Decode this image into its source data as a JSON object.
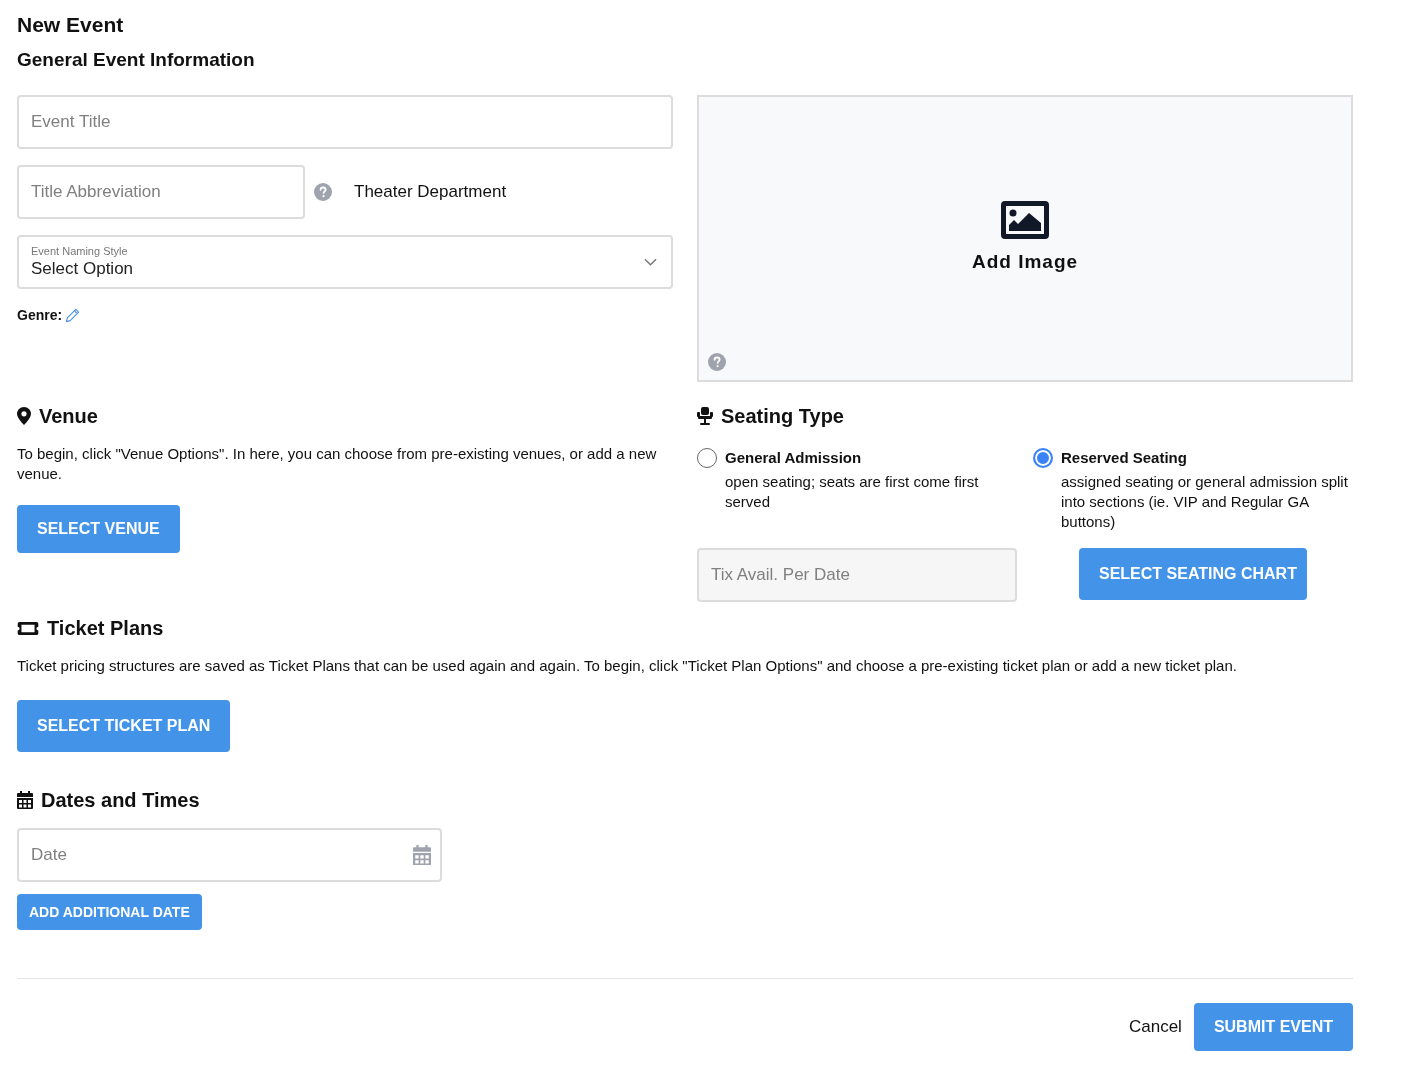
{
  "title": "New Event",
  "subtitle": "General Event Information",
  "event_title": {
    "placeholder": "Event Title"
  },
  "title_abbreviation": {
    "placeholder": "Title Abbreviation"
  },
  "department": "Theater Department",
  "naming_style": {
    "label": "Event Naming Style",
    "value": "Select Option"
  },
  "genre_label": "Genre:",
  "image": {
    "label": "Add Image"
  },
  "venue": {
    "heading": "Venue",
    "text": "To begin, click \"Venue Options\". In here, you can choose from pre-existing venues, or add a new venue.",
    "button": "SELECT VENUE"
  },
  "seating": {
    "heading": "Seating Type",
    "options": [
      {
        "label": "General Admission",
        "description": "open seating; seats are first come first served",
        "selected": false
      },
      {
        "label": "Reserved Seating",
        "description": "assigned seating or general admission split into sections (ie. VIP and Regular GA buttons)",
        "selected": true
      }
    ],
    "tix_field": {
      "placeholder": "Tix Avail. Per Date"
    },
    "button": "SELECT SEATING CHART"
  },
  "ticket_plans": {
    "heading": "Ticket Plans",
    "text": "Ticket pricing structures are saved as Ticket Plans that can be used again and again. To begin, click \"Ticket Plan Options\" and choose a pre-existing ticket plan or add a new ticket plan.",
    "button": "SELECT TICKET PLAN"
  },
  "dates": {
    "heading": "Dates and Times",
    "date_field": {
      "placeholder": "Date"
    },
    "button": "ADD ADDITIONAL DATE"
  },
  "footer": {
    "cancel": "Cancel",
    "submit": "SUBMIT EVENT"
  }
}
